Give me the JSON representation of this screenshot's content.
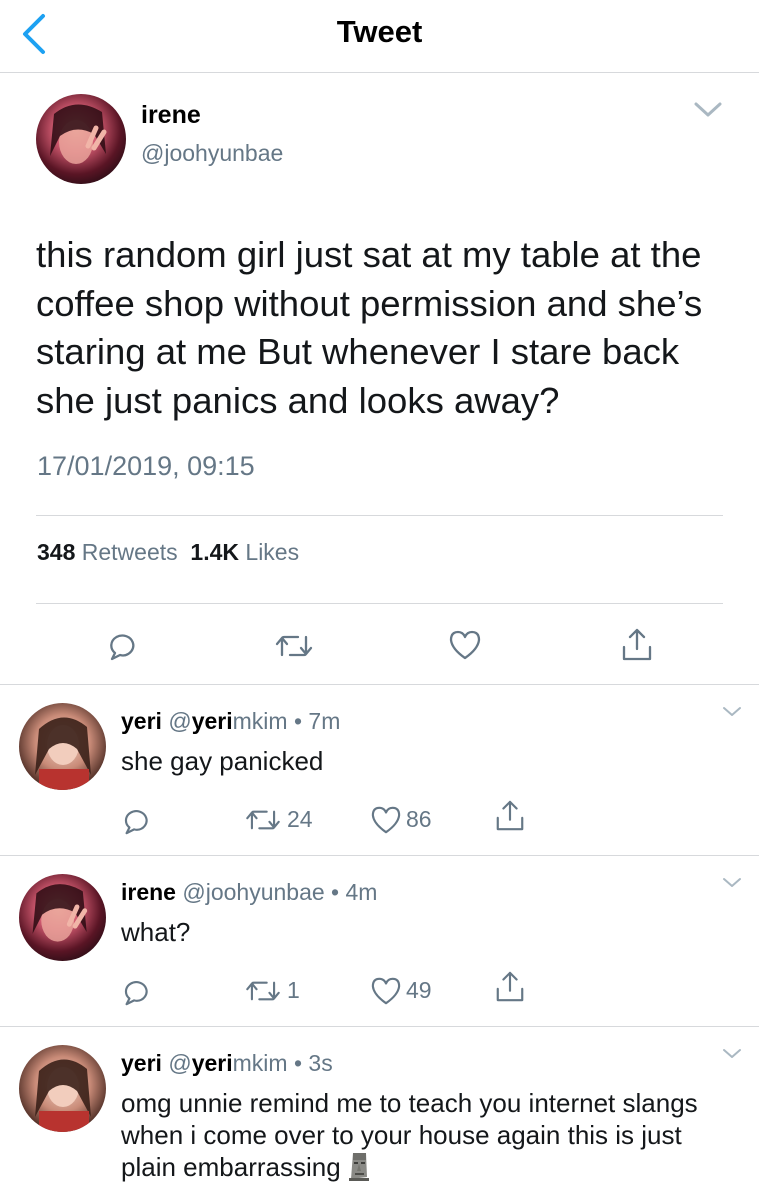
{
  "nav": {
    "title": "Tweet",
    "back_icon": "chevron-left-icon"
  },
  "colors": {
    "accent": "#1da1f2",
    "secondary_text": "#657786",
    "divider": "#d7d9dc"
  },
  "main_tweet": {
    "name": "irene",
    "handle": "@joohyunbae",
    "text": "this random girl just sat at my table at the coffee shop without permission and she’s staring at me But whenever I stare back she just panics and looks away?",
    "timestamp": "17/01/2019, 09:15",
    "retweets_count": "348",
    "retweets_label": "Retweets",
    "likes_count": "1.4K",
    "likes_label": "Likes"
  },
  "replies": [
    {
      "name": "yeri",
      "handle_prefix": "@",
      "handle_bold": "yeri",
      "handle_rest": "mkim",
      "separator": " • ",
      "time": "7m",
      "text": "she gay panicked",
      "retweets": "24",
      "likes": "86"
    },
    {
      "name": "irene",
      "handle": "@joohyunbae",
      "separator": " • ",
      "time": "4m",
      "text": "what?",
      "retweets": "1",
      "likes": "49"
    },
    {
      "name": "yeri",
      "handle_prefix": "@",
      "handle_bold": "yeri",
      "handle_rest": "mkim",
      "separator": " • ",
      "time": "3s",
      "text": "omg unnie remind me to teach you internet slangs when i come over to your house again this is just plain embarrassing",
      "emoji": "moai-emoji"
    }
  ]
}
